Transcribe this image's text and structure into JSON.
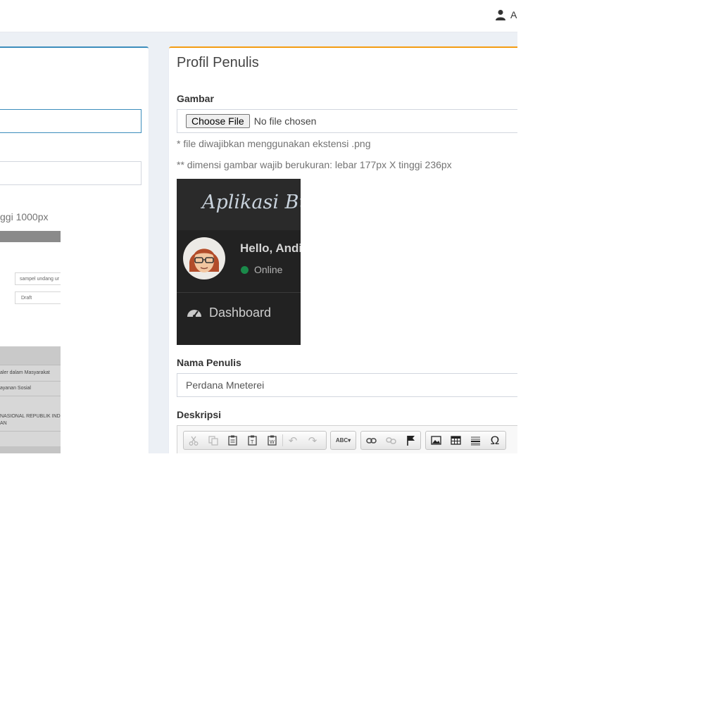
{
  "topbar": {
    "user_name": "Ar"
  },
  "left_panel": {
    "help_text": "ggi 1000px",
    "thumbnail": {
      "field_value_1": "sampel undang ur",
      "field_value_2": "Draft",
      "rows": [
        "aler dalam Masyarakat",
        "ayanan Sosial",
        "NASIONAL REPUBLIK INDO",
        "AN"
      ]
    }
  },
  "profile": {
    "title": "Profil Penulis",
    "image_label": "Gambar",
    "file_button": "Choose File",
    "file_status": "No file chosen",
    "help_ext": "* file diwajibkan menggunakan ekstensi .png",
    "help_dim": "** dimensi gambar wajib berukuran: lebar 177px X tinggi 236px",
    "preview": {
      "app_title": "Aplikasi Buk",
      "greeting": "Hello, Andi",
      "status": "Online",
      "menu_item": "Dashboard"
    },
    "name_label": "Nama Penulis",
    "name_value": "Perdana Mneterei",
    "desc_label": "Deskripsi"
  },
  "colors": {
    "primary_border": "#3c8dbc",
    "warning_border": "#f39c12",
    "online_dot": "#00a65a"
  },
  "toolbar_icons": [
    "cut-icon",
    "copy-icon",
    "paste-icon",
    "paste-text-icon",
    "paste-word-icon",
    "undo-icon",
    "redo-icon",
    "spellcheck-icon",
    "link-icon",
    "unlink-icon",
    "anchor-icon",
    "image-icon",
    "table-icon",
    "horizontal-rule-icon",
    "special-char-icon"
  ]
}
